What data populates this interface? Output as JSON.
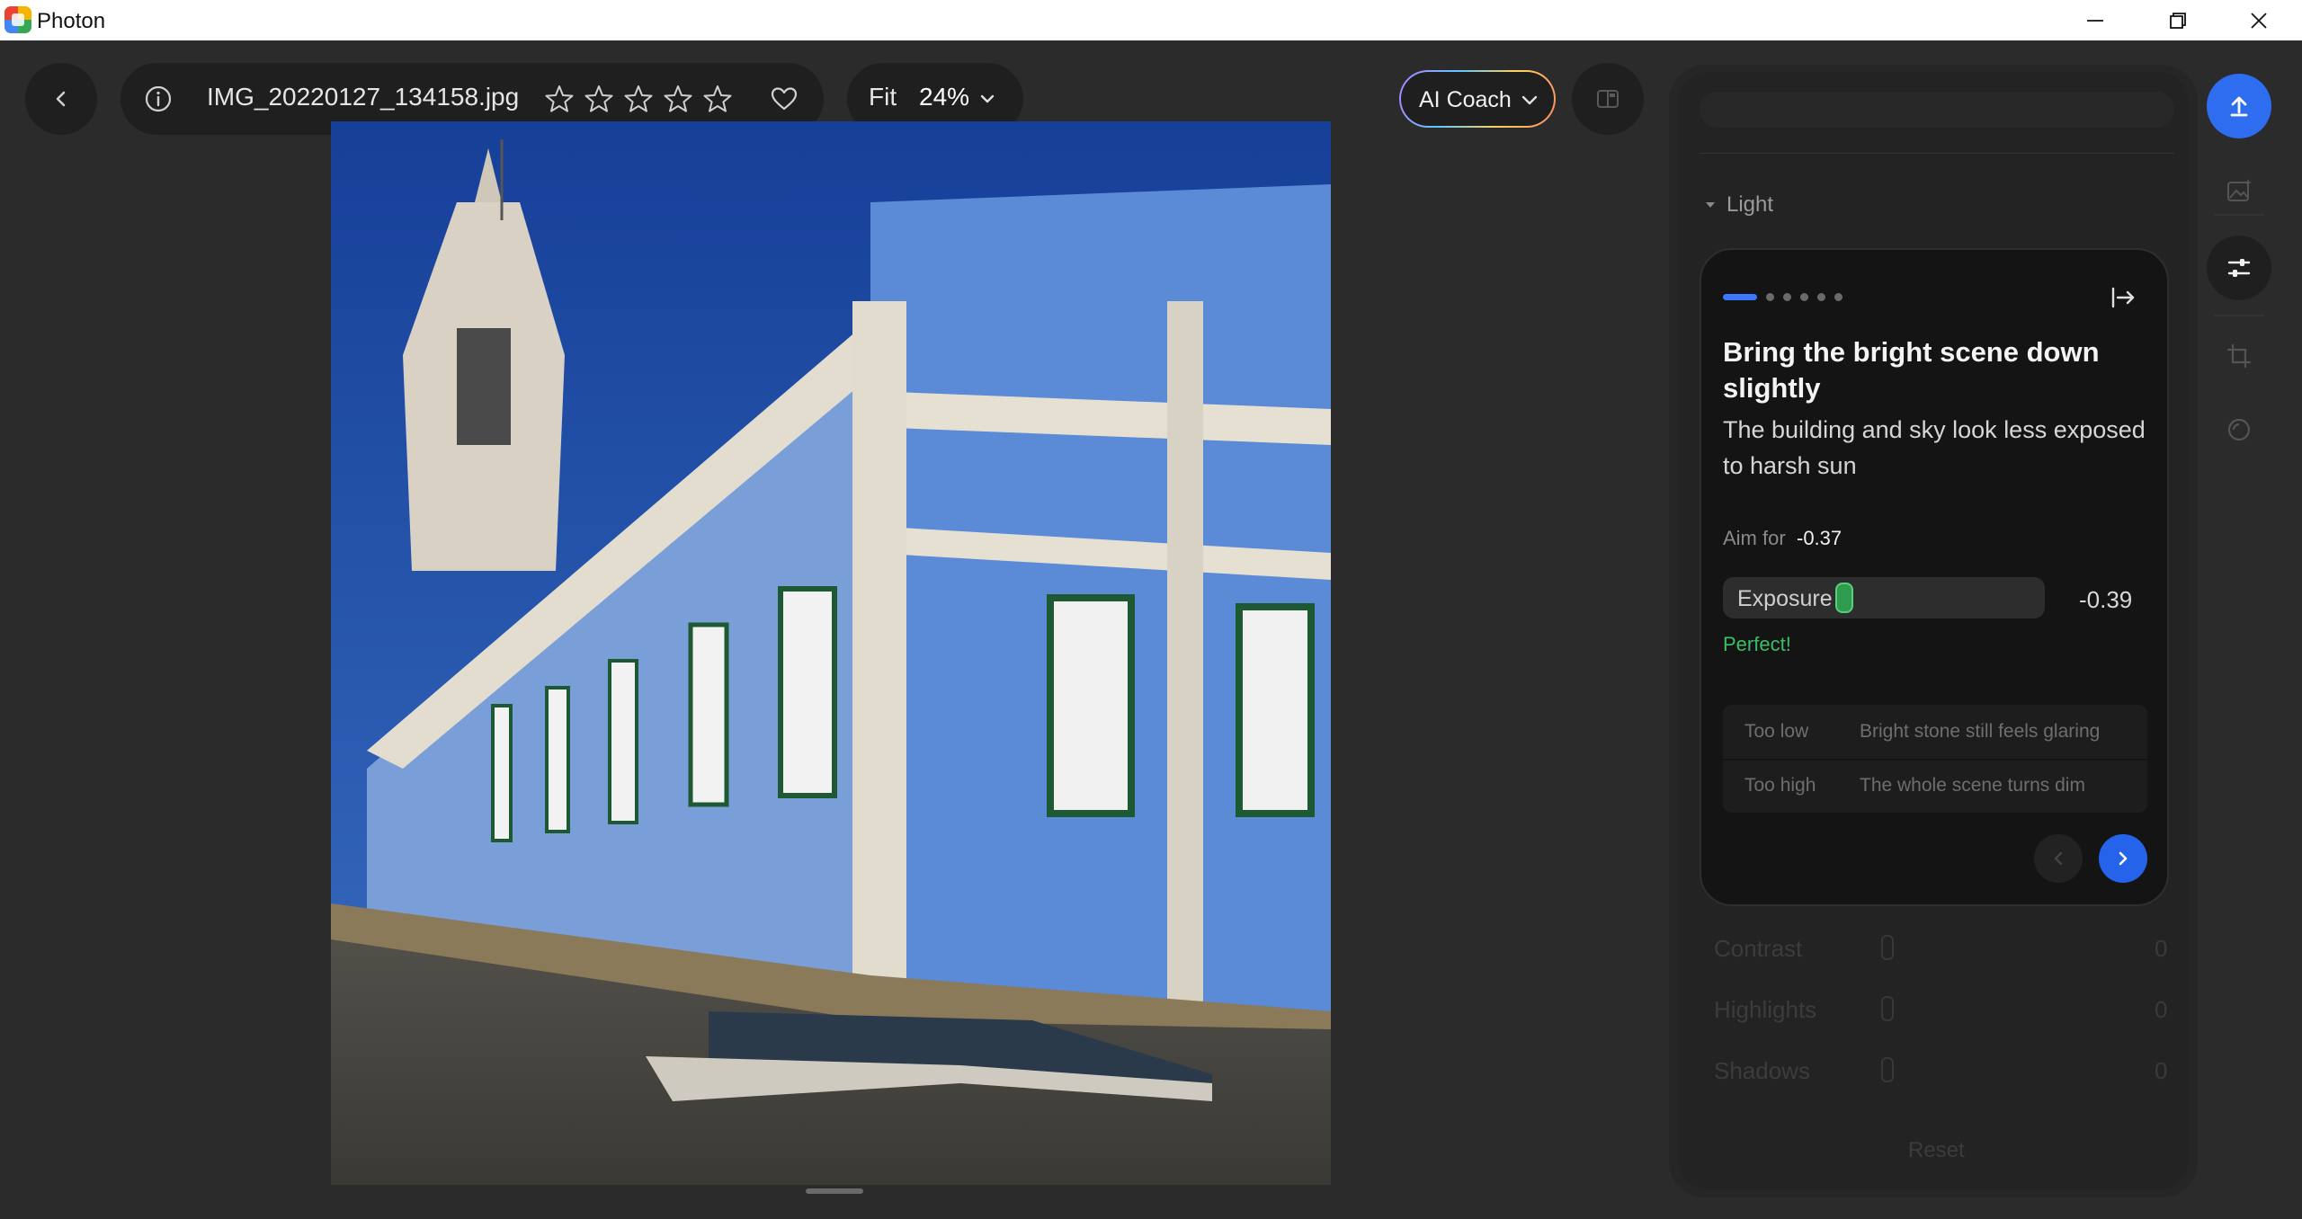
{
  "app": {
    "title": "Photon"
  },
  "window_controls": [
    "minimize-icon",
    "restore-icon",
    "close-icon"
  ],
  "toolbar": {
    "file_name": "IMG_20220127_134158.jpg",
    "rating": {
      "value": 0,
      "max": 5
    },
    "fit_label": "Fit",
    "zoom": "24%",
    "coach_label": "AI Coach"
  },
  "panel": {
    "section": "Light",
    "sliders": [
      {
        "label": "Contrast",
        "value": "0"
      },
      {
        "label": "Highlights",
        "value": "0"
      },
      {
        "label": "Shadows",
        "value": "0"
      }
    ],
    "reset_label": "Reset"
  },
  "coach": {
    "step": {
      "current": 1,
      "total": 6
    },
    "title": "Bring the bright scene down slightly",
    "description": "The building and sky look less exposed to harsh sun",
    "aim_label": "Aim for",
    "aim_value": "-0.37",
    "slider": {
      "label": "Exposure",
      "value": "-0.39",
      "position": 0.37
    },
    "feedback": "Perfect!",
    "hints": [
      {
        "key": "Too low",
        "text": "Bright stone still feels glaring"
      },
      {
        "key": "Too high",
        "text": "The whole scene turns dim"
      }
    ]
  },
  "colors": {
    "accent": "#2f6df0",
    "success": "#3dbd66",
    "background": "#2b2b2b"
  }
}
